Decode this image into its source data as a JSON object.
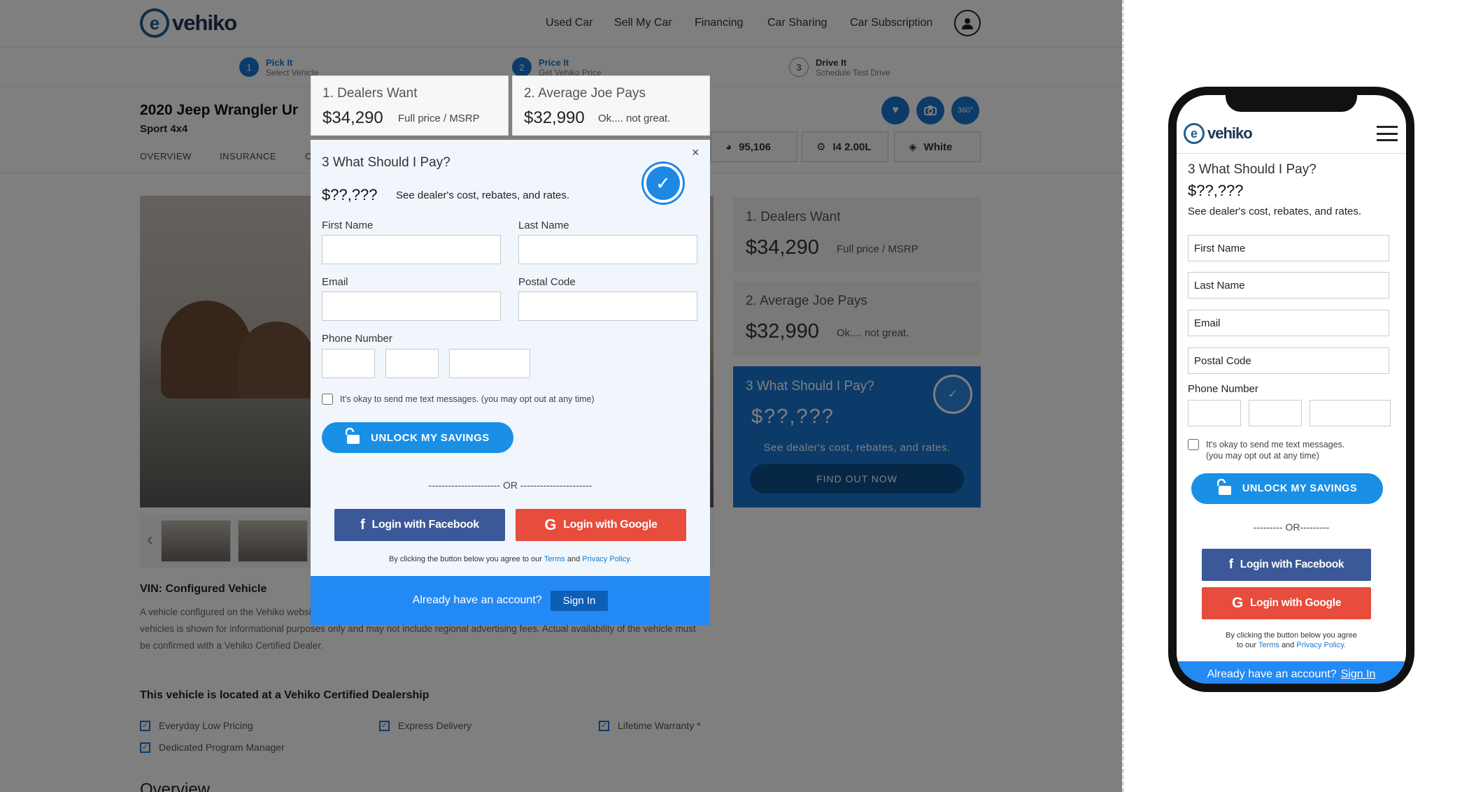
{
  "brand": {
    "name": "vehiko",
    "logo_glyph": "e"
  },
  "nav": {
    "items": [
      "Used Car",
      "Sell My Car",
      "Financing",
      "Car Sharing",
      "Car Subscription"
    ]
  },
  "steps": [
    {
      "num": "1",
      "title": "Pick It",
      "sub": "Select Vehicle"
    },
    {
      "num": "2",
      "title": "Price It",
      "sub": "Get Vehiko Price"
    },
    {
      "num": "3",
      "title": "Drive It",
      "sub": "Schedule Test Drive"
    }
  ],
  "vehicle": {
    "title": "2020 Jeep Wrangler Ur",
    "subtitle": "Sport 4x4",
    "tabs": [
      "OVERVIEW",
      "INSURANCE",
      "C"
    ],
    "specs": {
      "mileage": "95,106",
      "engine": "I4 2.00L",
      "color": "White"
    },
    "icon_360": "360°"
  },
  "vin": {
    "label": "VIN: Configured Vehicle",
    "desc": "A vehicle configured on the Vehiko website obtain a configured vehicle from a manufacturer or another source. Pricing on configured vehicles is shown for informational purposes only and may not include regional advertising fees. Actual availability of the vehicle must be confirmed with a Vehiko Certified Dealer."
  },
  "location": {
    "heading": "This vehicle is located at a Vehiko Certified Dealership",
    "features": [
      "Everyday Low Pricing",
      "Express Delivery",
      "Lifetime Warranty *",
      "Dedicated Program Manager"
    ]
  },
  "overview_heading": "Overview",
  "pricing": {
    "dealers": {
      "title": "1. Dealers Want",
      "price": "$34,290",
      "note": "Full price / MSRP"
    },
    "average": {
      "title": "2. Average Joe Pays",
      "price": "$32,990",
      "note": "Ok.... not great."
    },
    "should": {
      "title": "3 What Should I Pay?",
      "price": "$??,???",
      "desc": "See dealer's cost, rebates, and rates.",
      "cta": "FIND OUT NOW"
    }
  },
  "modal": {
    "close": "×",
    "heading": "3 What Should I Pay?",
    "price": "$??,???",
    "desc": "See dealer's cost, rebates, and rates.",
    "fields": {
      "first_name": "First Name",
      "last_name": "Last Name",
      "email": "Email",
      "postal": "Postal Code",
      "phone": "Phone Number"
    },
    "sms_consent": "It's okay to send me text messages. (you may opt out at any time)",
    "unlock": "UNLOCK MY SAVINGS",
    "or": "---------------------- OR ----------------------",
    "facebook": "Login with Facebook",
    "google": "Login with Google",
    "agree_pre": "By clicking the button below you agree to our",
    "terms": "Terms",
    "and": "and",
    "privacy": "Privacy Policy.",
    "have_account": "Already have an account?",
    "signin": "Sign In"
  },
  "mobile": {
    "heading": "3 What Should I Pay?",
    "price": "$??,???",
    "desc": "See dealer's cost, rebates, and rates.",
    "placeholders": {
      "first_name": "First Name",
      "last_name": "Last Name",
      "email": "Email",
      "postal": "Postal Code"
    },
    "phone_label": "Phone Number",
    "sms_line1": "It's okay to send me text messages.",
    "sms_line2": "(you may opt out at any time)",
    "unlock": "UNLOCK MY SAVINGS",
    "or": "--------- OR---------",
    "facebook": "Login with Facebook",
    "google": "Login with Google",
    "agree_line1": "By clicking the button below you agree",
    "agree_pre2": "to our",
    "terms": "Terms",
    "and": "and",
    "privacy": "Privacy Policy.",
    "have_account": "Already have an account?",
    "signin": "Sign In"
  },
  "colors": {
    "primary": "#1976d2",
    "facebook": "#3b5998",
    "google": "#e74c3c",
    "footer_blue": "#2389f5"
  }
}
